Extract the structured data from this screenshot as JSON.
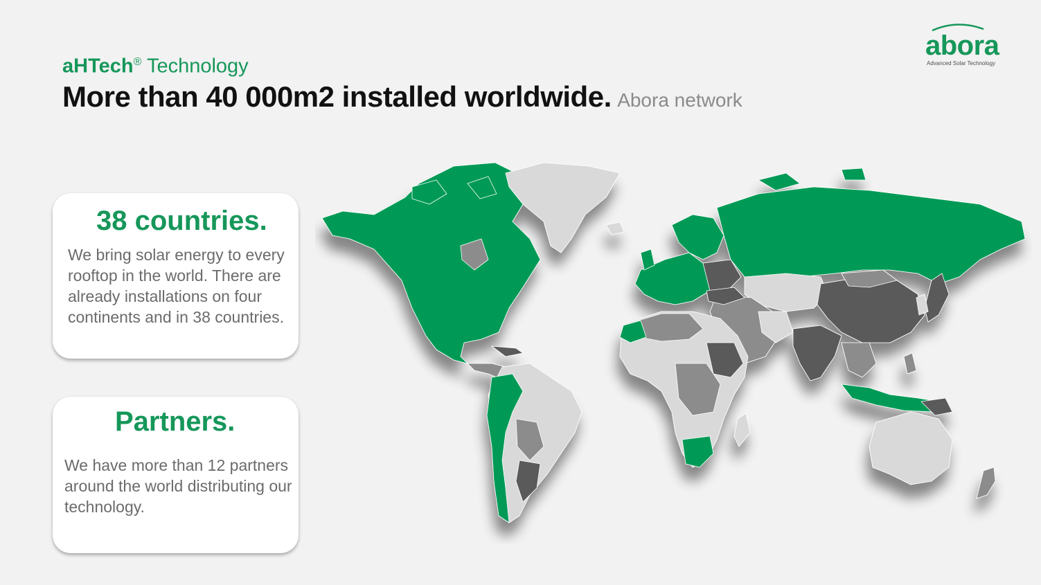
{
  "header": {
    "brand": "aHTech",
    "registered_mark": "®",
    "subtitle_rest": " Technology",
    "title": "More than 40 000m2 installed worldwide.",
    "title_aside": "Abora network"
  },
  "logo": {
    "wordmark": "abora",
    "tagline": "Advanced Solar Technology"
  },
  "cards": [
    {
      "title": "38 countries.",
      "text": "We bring solar energy to every rooftop in the world. There are already installations on four continents and in 38 countries."
    },
    {
      "title": "Partners.",
      "text": "We have more than 12 partners around the world distributing our technology."
    }
  ],
  "colors": {
    "accent": "#16975a",
    "map_highlight": "#009a57",
    "map_dark": "#5a5a5a",
    "map_mid": "#8c8c8c",
    "map_light": "#d9d9d9",
    "background": "#f2f2f2"
  }
}
